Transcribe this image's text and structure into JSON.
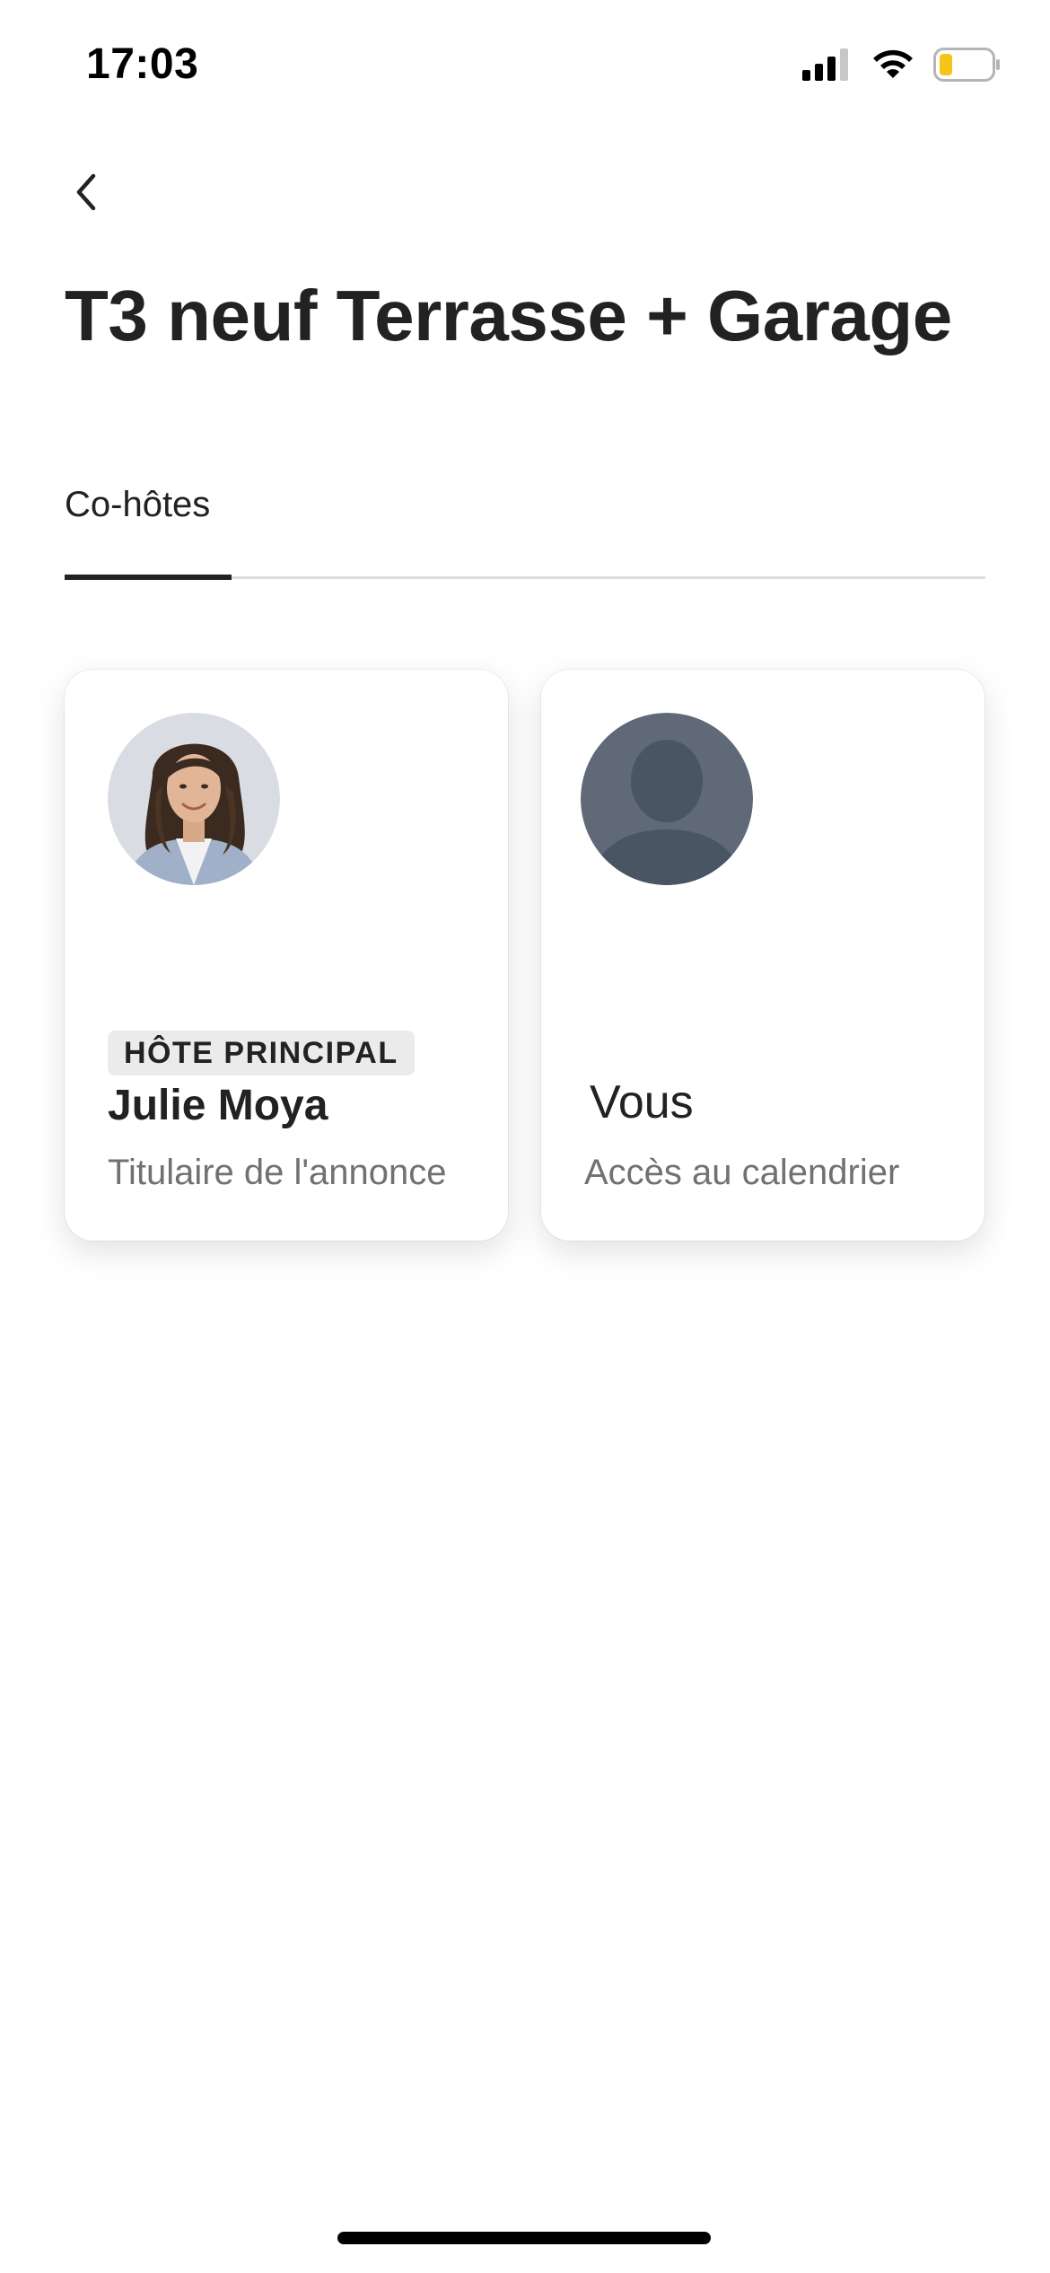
{
  "status_bar": {
    "time": "17:03",
    "icons": [
      "cellular-signal-icon",
      "wifi-icon",
      "battery-icon"
    ],
    "battery_color": "#f5c518"
  },
  "nav": {
    "back_icon": "chevron-left-icon"
  },
  "page": {
    "title": "T3 neuf Terrasse + Garage"
  },
  "tabs": [
    {
      "label": "Co-hôtes",
      "selected": true
    }
  ],
  "cohosts": [
    {
      "badge": "HÔTE PRINCIPAL",
      "name": "Julie Moya",
      "role": "Titulaire de l'annonce",
      "avatar": "photo"
    },
    {
      "name": "Vous",
      "role": "Accès au calendrier",
      "avatar": "default-silhouette"
    }
  ],
  "colors": {
    "text_primary": "#222222",
    "text_secondary": "#717171",
    "divider": "#dddddd",
    "badge_bg": "#ebebeb",
    "silhouette_bg": "#5f6977",
    "silhouette_fg": "#4a5563"
  }
}
